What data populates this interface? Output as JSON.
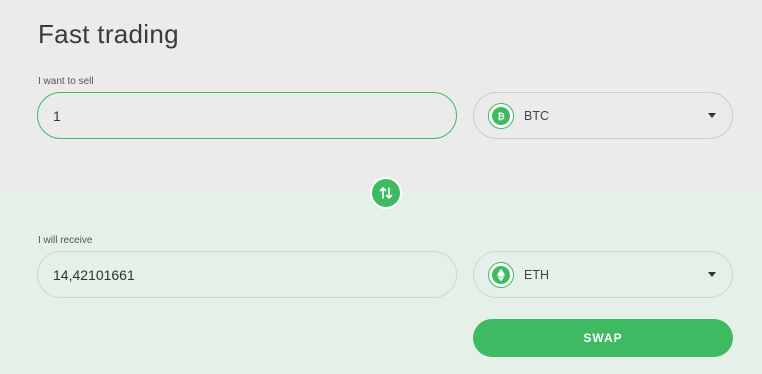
{
  "title": "Fast trading",
  "sell": {
    "label": "I want to sell",
    "amount": "1",
    "currency": "BTC",
    "currency_icon": "bitcoin-icon"
  },
  "receive": {
    "label": "I will receive",
    "amount": "14,42101661",
    "currency": "ETH",
    "currency_icon": "ethereum-icon"
  },
  "swap_button_label": "SWAP",
  "colors": {
    "accent": "#3dba62",
    "top_background": "#ebebeb",
    "bottom_background": "#e5f1e8"
  }
}
